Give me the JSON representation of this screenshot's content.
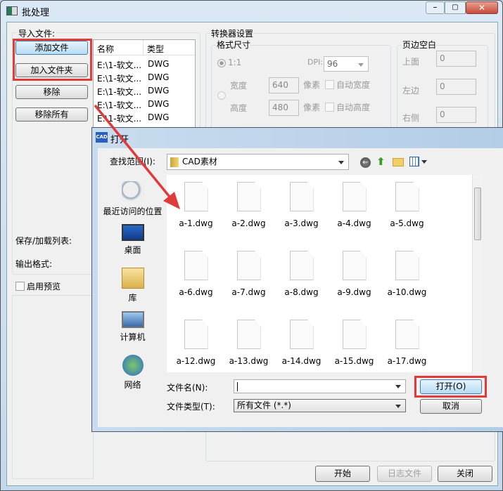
{
  "main": {
    "title": "批处理",
    "import_label": "导入文件:",
    "buttons": {
      "add_file": "添加文件",
      "add_folder": "加入文件夹",
      "remove": "移除",
      "remove_all": "移除所有"
    },
    "list": {
      "headers": [
        "名称",
        "类型"
      ],
      "rows": [
        [
          "E:\\1-软文...",
          "DWG"
        ],
        [
          "E:\\1-软文...",
          "DWG"
        ],
        [
          "E:\\1-软文...",
          "DWG"
        ],
        [
          "E:\\1-软文...",
          "DWG"
        ],
        [
          "E:\\1-软文...",
          "DWG"
        ]
      ]
    },
    "converter": {
      "title": "转换器设置",
      "format_size": "格式尺寸",
      "ratio": "1:1",
      "dpi_label": "DPI:",
      "dpi_value": "96",
      "width_label": "宽度",
      "width_value": "640",
      "height_label": "高度",
      "height_value": "480",
      "pixel": "像素",
      "auto_width": "自动宽度",
      "auto_height": "自动高度"
    },
    "margins": {
      "title": "页边空白",
      "top_label": "上面",
      "top": "0",
      "left_label": "左边",
      "left": "0",
      "right_label": "右侧",
      "right": "0"
    },
    "save_load": "保存/加载列表:",
    "output_format": "输出格式:",
    "preview": "启用预览",
    "footer": {
      "start": "开始",
      "log": "日志文件",
      "close": "关闭"
    }
  },
  "dialog": {
    "title": "打开",
    "app_icon": "CAD",
    "look_in_label": "查找范围(I):",
    "look_in_value": "CAD素材",
    "places": [
      "最近访问的位置",
      "桌面",
      "库",
      "计算机",
      "网络"
    ],
    "files": [
      "a-1.dwg",
      "a-2.dwg",
      "a-3.dwg",
      "a-4.dwg",
      "a-5.dwg",
      "a-6.dwg",
      "a-7.dwg",
      "a-8.dwg",
      "a-9.dwg",
      "a-10.dwg",
      "a-12.dwg",
      "a-13.dwg",
      "a-14.dwg",
      "a-15.dwg",
      "a-17.dwg"
    ],
    "filename_label": "文件名(N):",
    "filename_value": "",
    "filetype_label": "文件类型(T):",
    "filetype_value": "所有文件 (*.*)",
    "open": "打开(O)",
    "cancel": "取消"
  },
  "colors": {
    "highlight": "#e03a3a",
    "accent": "#3c7fb1"
  }
}
